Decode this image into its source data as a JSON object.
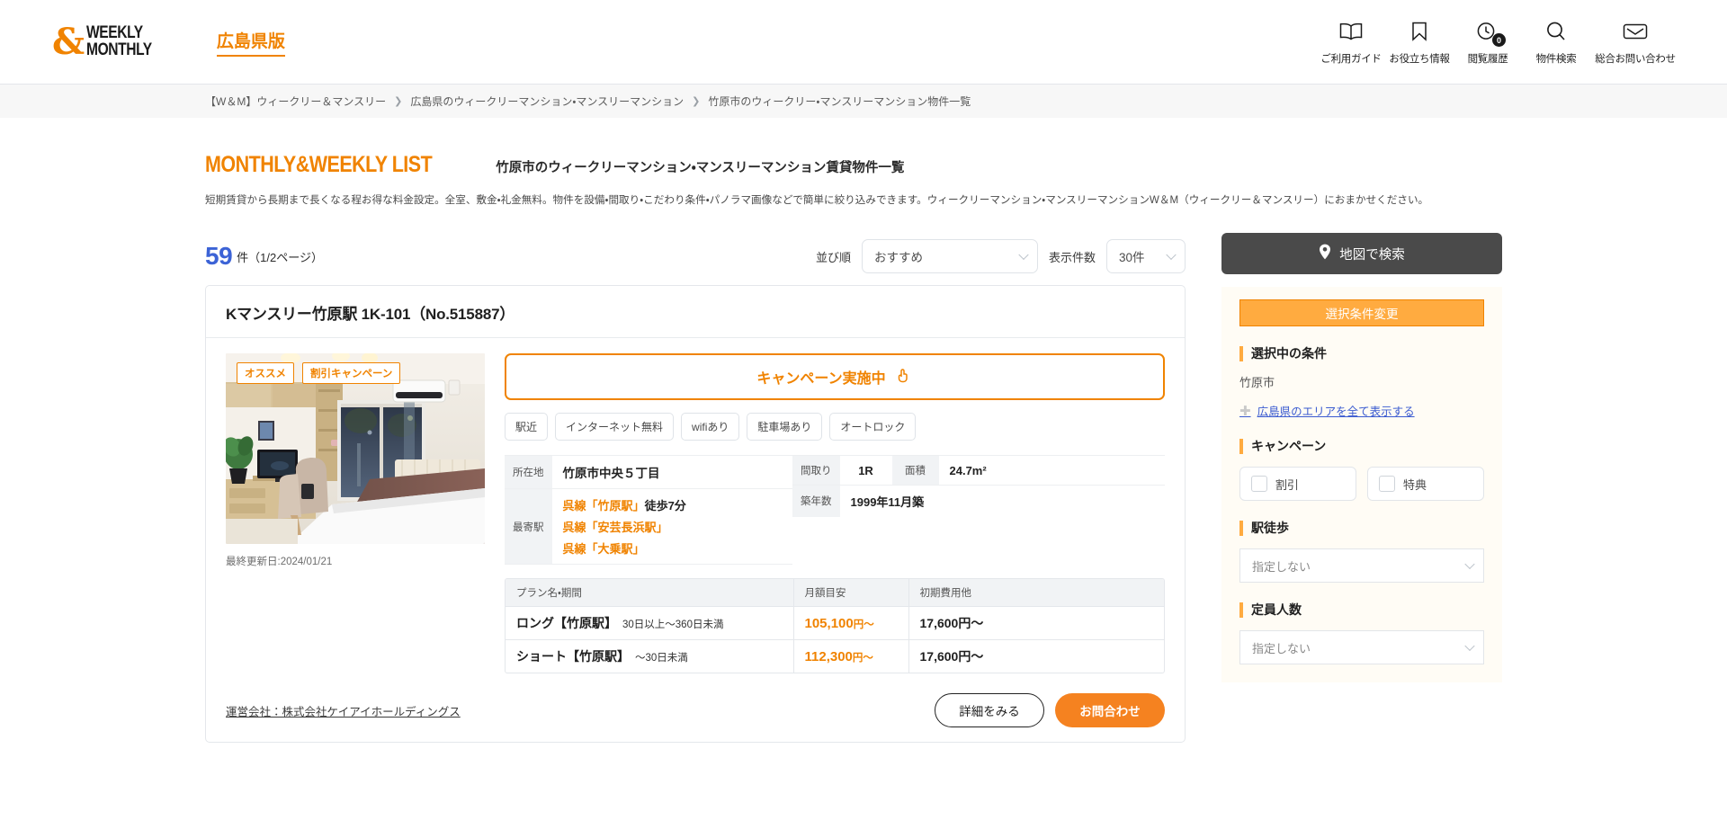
{
  "header": {
    "logo_line1": "WEEKLY",
    "logo_line2": "MONTHLY",
    "logo_mark": "&",
    "region_badge": "広島県版",
    "nav": [
      {
        "label": "ご利用ガイド",
        "icon": "book-icon"
      },
      {
        "label": "お役立ち情報",
        "icon": "bookmark-icon"
      },
      {
        "label": "閲覧履歴",
        "icon": "history-clock-icon",
        "badge": "0"
      },
      {
        "label": "物件検索",
        "icon": "search-icon"
      },
      {
        "label": "総合お問い合わせ",
        "icon": "mail-icon"
      }
    ]
  },
  "breadcrumb": [
    "【W＆M】ウィークリー＆マンスリー",
    "広島県のウィークリーマンション・マンスリーマンション",
    "竹原市のウィークリー・マンスリーマンション物件一覧"
  ],
  "page": {
    "title_en": "MONTHLY&WEEKLY LIST",
    "title_ja": "竹原市のウィークリーマンション・マンスリーマンション賃貸物件一覧",
    "lede": "短期賃貸から長期まで長くなる程お得な料金設定。全室、敷金・礼金無料。物件を設備・間取り・こだわり条件・パノラマ画像などで簡単に絞り込みできます。ウィークリーマンション・マンスリーマンションW＆M（ウィークリー＆マンスリー）におまかせください。"
  },
  "toolbar": {
    "count": "59",
    "count_unit": "件",
    "page_info": "（1/2ページ）",
    "sort_label": "並び順",
    "sort_value": "おすすめ",
    "per_page_label": "表示件数",
    "per_page_value": "30件"
  },
  "property": {
    "title": "Kマンスリー竹原駅 1K-101（No.515887）",
    "badges": [
      "オススメ",
      "割引キャンペーン"
    ],
    "updated": "最終更新日:2024/01/21",
    "campaign": "キャンペーン実施中",
    "campaign_icon": "pointing-hand-icon",
    "tags": [
      "駅近",
      "インターネット無料",
      "wifiあり",
      "駐車場あり",
      "オートロック"
    ],
    "spec": {
      "address_label": "所在地",
      "address_value": "竹原市中央５丁目",
      "station_label": "最寄駅",
      "stations": [
        {
          "line": "呉線",
          "name": "竹原駅",
          "walk": "徒歩7分"
        },
        {
          "line": "呉線",
          "name": "安芸長浜駅",
          "walk": ""
        },
        {
          "line": "呉線",
          "name": "大乗駅",
          "walk": ""
        }
      ],
      "layout_label": "間取り",
      "layout_value": "1R",
      "area_label": "面積",
      "area_value": "24.7m²",
      "age_label": "築年数",
      "age_value": "1999年11月築"
    },
    "plan_table": {
      "headers": [
        "プラン名・期間",
        "月額目安",
        "初期費用他"
      ],
      "rows": [
        {
          "name": "ロング【竹原駅】",
          "term": "30日以上〜360日未満",
          "monthly": "105,100",
          "monthly_unit": "円〜",
          "initial": "17,600円〜"
        },
        {
          "name": "ショート【竹原駅】",
          "term": "〜30日未満",
          "monthly": "112,300",
          "monthly_unit": "円〜",
          "initial": "17,600円〜"
        }
      ]
    },
    "company": "運営会社：株式会社ケイアイホールディングス",
    "detail_button": "詳細をみる",
    "contact_button": "お問合わせ"
  },
  "sidebar": {
    "map_button": "地図で検索",
    "map_icon": "map-pin-icon",
    "change_conditions": "選択条件変更",
    "selected_heading": "選択中の条件",
    "selected_value": "竹原市",
    "expand_link": "広島県のエリアを全て表示する",
    "campaign_heading": "キャンペーン",
    "campaign_options": [
      "割引",
      "特典"
    ],
    "walk_heading": "駅徒歩",
    "walk_value": "指定しない",
    "capacity_heading": "定員人数",
    "capacity_value": "指定しない"
  },
  "colors": {
    "brand_orange": "#f08300",
    "accent_orange": "#ffab40",
    "button_orange": "#f58220",
    "count_blue": "#3c63d6",
    "link_blue": "#3b5bd0",
    "dark_gray": "#4a4a4a"
  }
}
